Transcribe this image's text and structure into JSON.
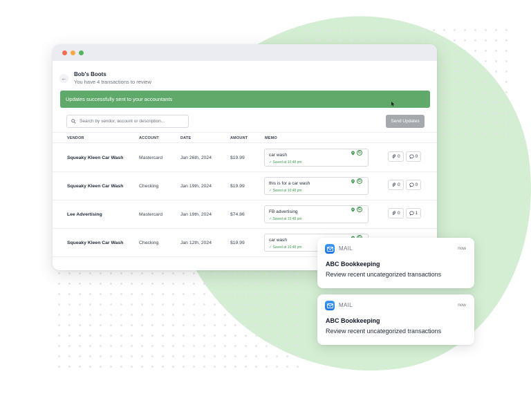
{
  "window": {
    "shop_name": "Bob's Boots",
    "review_subtitle": "You have 4 transactions to review",
    "banner_text": "Updates successfully sent to your accountants",
    "search_placeholder": "Search by vendor, account or description...",
    "send_button": "Send Updates"
  },
  "table": {
    "columns": [
      "VENDOR",
      "ACCOUNT",
      "DATE",
      "AMOUNT",
      "MEMO"
    ],
    "rows": [
      {
        "vendor": "Squeaky Kleen Car Wash",
        "account": "Mastercard",
        "date": "Jan 26th, 2024",
        "amount": "$19.99",
        "memo": "car wash",
        "saved": "✓ Saved at 10:48 pm",
        "attachments": "0",
        "comments": "0"
      },
      {
        "vendor": "Squeaky Kleen Car Wash",
        "account": "Checking",
        "date": "Jan 19th, 2024",
        "amount": "$19.99",
        "memo": "this is for a car wash",
        "saved": "✓ Saved at 10:48 pm",
        "attachments": "0",
        "comments": "0"
      },
      {
        "vendor": "Lee Advertising",
        "account": "Mastercard",
        "date": "Jan 19th, 2024",
        "amount": "$74.86",
        "memo": "FB advertising",
        "saved": "✓ Saved at 10:48 pm",
        "attachments": "0",
        "comments": "1"
      },
      {
        "vendor": "Squeaky Kleen Car Wash",
        "account": "Checking",
        "date": "Jan 12th, 2024",
        "amount": "$19.99",
        "memo": "car wash",
        "saved": "✓ Saved at 10:48 pm",
        "attachments": "",
        "comments": ""
      }
    ]
  },
  "notifications": [
    {
      "app": "MAIL",
      "time": "now",
      "title": "ABC Bookkeeping",
      "body": "Review recent uncategorized transactions"
    },
    {
      "app": "MAIL",
      "time": "now",
      "title": "ABC Bookkeeping",
      "body": "Review recent uncategorized transactions"
    }
  ],
  "colors": {
    "banner": "#5fa96a",
    "blob": "#d3eed3",
    "saved_text": "#3f9a4f",
    "send_button": "#a5a9ae"
  }
}
